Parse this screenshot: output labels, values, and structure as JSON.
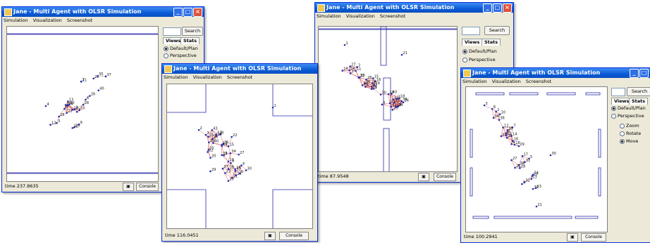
{
  "app": {
    "title": "Jane - Multi Agent with OLSR Simulation",
    "menu": [
      "Simulation",
      "Visualization",
      "Screenshot"
    ],
    "search_label": "Search",
    "tabs": [
      "Views",
      "Stats"
    ],
    "view_options": [
      "Default/Plan",
      "Perspective"
    ],
    "perspective_sub": [
      "Zoom",
      "Rotate",
      "Move"
    ],
    "console_label": "Console"
  },
  "windows": [
    {
      "id": "w1",
      "time": "time 237.8635",
      "view_selected": "Default/Plan",
      "labels": [
        "4",
        "1",
        "2",
        "3",
        "24",
        "25",
        "20",
        "22",
        "30",
        "10",
        "12",
        "29",
        "26",
        "23",
        "28",
        "13",
        "21",
        "40",
        "37",
        "6",
        "8",
        "7",
        "9",
        "18",
        "31",
        "35"
      ]
    },
    {
      "id": "w2",
      "time": "time 116.0451",
      "labels": [
        "1",
        "2",
        "26",
        "40",
        "32",
        "22",
        "12",
        "21",
        "15",
        "37",
        "29",
        "3",
        "6",
        "8",
        "20",
        "31",
        "39",
        "35",
        "25",
        "11",
        "23",
        "17",
        "9",
        "36",
        "43",
        "34",
        "14",
        "19",
        "27",
        "32",
        "10",
        "7",
        "18",
        "16",
        "30",
        "4",
        "38"
      ]
    },
    {
      "id": "w3",
      "time": "time 87.9548",
      "view_selected": "Default/Plan",
      "labels": [
        "1",
        "21",
        "26",
        "25",
        "19",
        "17",
        "23",
        "3",
        "24",
        "36",
        "15",
        "34",
        "28",
        "16",
        "13",
        "11",
        "22",
        "27",
        "30",
        "2",
        "5",
        "31",
        "20",
        "14",
        "33",
        "38",
        "8",
        "35",
        "6",
        "40",
        "18",
        "12",
        "7",
        "29",
        "9",
        "10",
        "4"
      ]
    },
    {
      "id": "w4",
      "time": "time 100.2941",
      "view_selected": "Default/Plan",
      "sub_selected": "Move",
      "labels": [
        "3",
        "30",
        "39",
        "21",
        "12",
        "25",
        "4",
        "34",
        "20",
        "14",
        "10",
        "27",
        "5",
        "26",
        "18",
        "15",
        "9",
        "23",
        "13",
        "29",
        "2",
        "6",
        "32",
        "33",
        "7",
        "35",
        "38",
        "16",
        "8",
        "24",
        "28",
        "36",
        "17",
        "31"
      ]
    }
  ]
}
